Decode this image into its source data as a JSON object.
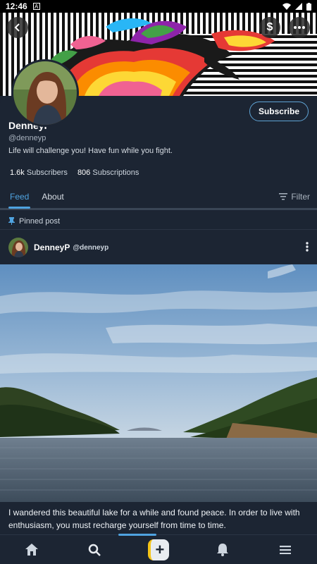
{
  "status_bar": {
    "time": "12:46",
    "notification": "A"
  },
  "profile": {
    "subscribe_label": "Subscribe",
    "name": "DenneyP",
    "handle": "@denneyp",
    "bio": "Life will challenge you! Have fun while you fight.",
    "subscribers_count": "1.6k",
    "subscribers_label": "Subscribers",
    "subscriptions_count": "806",
    "subscriptions_label": "Subscriptions"
  },
  "tabs": [
    {
      "label": "Feed",
      "active": true
    },
    {
      "label": "About",
      "active": false
    }
  ],
  "filter_label": "Filter",
  "post": {
    "pinned_label": "Pinned post",
    "author_name": "DenneyP",
    "author_handle": "@denneyp",
    "caption": "I wandered  this beautiful lake for a while and found peace. In order to live with enthusiasm, you must recharge yourself from time to time."
  },
  "icons": {
    "back": "chevron-left-icon",
    "tip": "dollar-icon",
    "more": "more-horizontal-icon",
    "pin": "pin-icon",
    "filter": "filter-icon",
    "post_menu": "more-vertical-icon",
    "nav": [
      "home-icon",
      "search-icon",
      "plus-icon",
      "bell-icon",
      "menu-icon"
    ]
  },
  "colors": {
    "accent": "#4fa3e0",
    "background": "#1c2533",
    "compose_accent": "#f5c518"
  }
}
